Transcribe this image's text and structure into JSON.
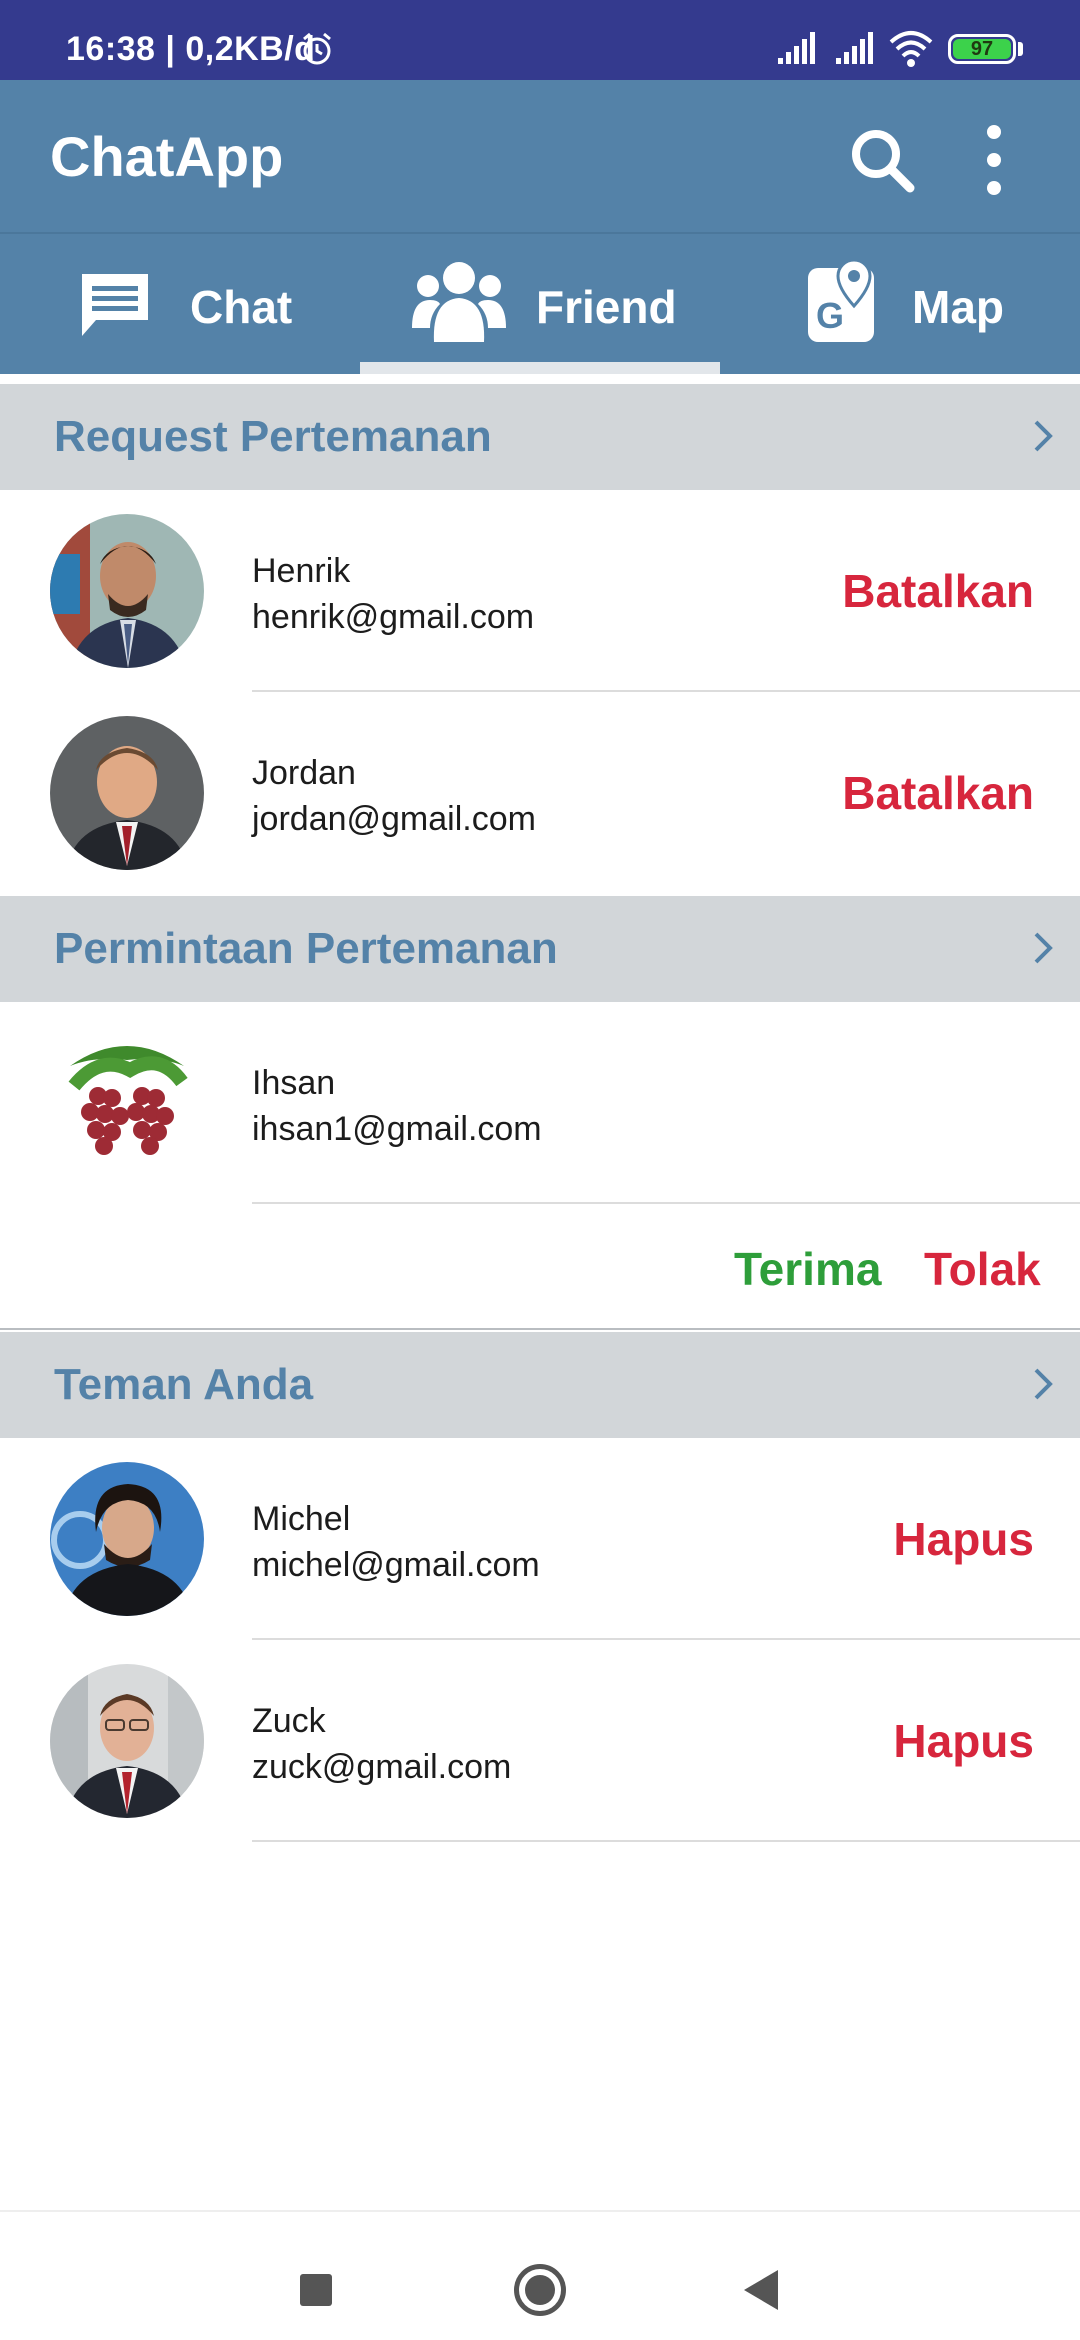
{
  "status_bar": {
    "time": "16:38 | 0,2KB/d",
    "battery": "97"
  },
  "app_bar": {
    "title": "ChatApp"
  },
  "tabs": [
    {
      "label": "Chat",
      "icon": "chat-bubble-icon"
    },
    {
      "label": "Friend",
      "icon": "group-icon",
      "selected": true
    },
    {
      "label": "Map",
      "icon": "map-icon"
    }
  ],
  "sections": {
    "requests": {
      "title": "Request Pertemanan",
      "items": [
        {
          "name": "Henrik",
          "email": "henrik@gmail.com",
          "action": "Batalkan"
        },
        {
          "name": "Jordan",
          "email": "jordan@gmail.com",
          "action": "Batalkan"
        }
      ]
    },
    "incoming": {
      "title": "Permintaan Pertemanan",
      "items": [
        {
          "name": "Ihsan",
          "email": "ihsan1@gmail.com"
        }
      ],
      "accept_label": "Terima",
      "reject_label": "Tolak"
    },
    "friends": {
      "title": "Teman Anda",
      "items": [
        {
          "name": "Michel",
          "email": "michel@gmail.com",
          "action": "Hapus"
        },
        {
          "name": "Zuck",
          "email": "zuck@gmail.com",
          "action": "Hapus"
        }
      ]
    }
  },
  "colors": {
    "status_bar": "#343a8e",
    "primary": "#5482a8",
    "section_bg": "#d2d6d9",
    "danger": "#d7263d",
    "success": "#2e9e3a"
  }
}
